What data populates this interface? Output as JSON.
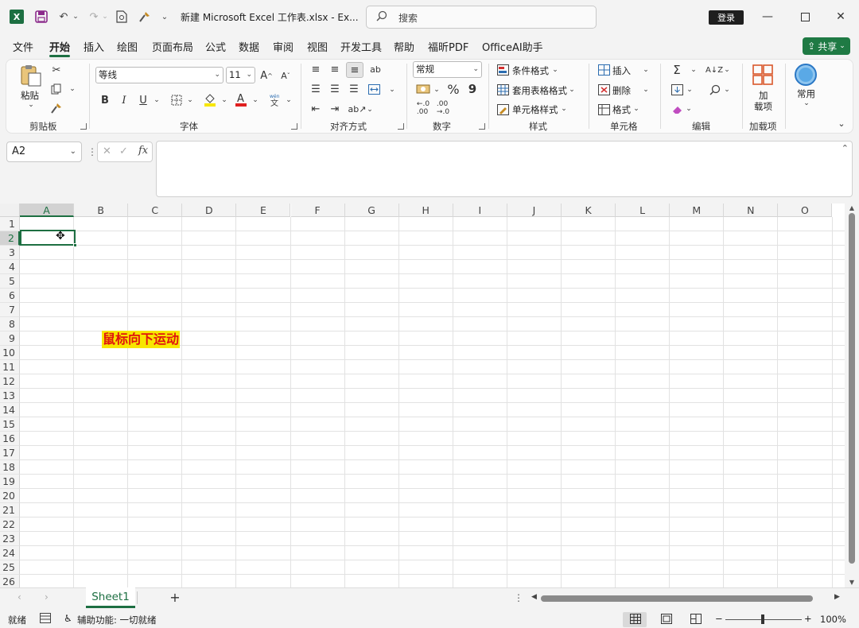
{
  "titlebar": {
    "doc_title": "新建 Microsoft Excel 工作表.xlsx  -  Ex...",
    "search_placeholder": "搜索",
    "login_label": "登录",
    "app_logo": "X"
  },
  "menu": {
    "items": [
      "文件",
      "开始",
      "插入",
      "绘图",
      "页面布局",
      "公式",
      "数据",
      "审阅",
      "视图",
      "开发工具",
      "帮助",
      "福昕PDF",
      "OfficeAI助手"
    ],
    "active": "开始",
    "share_label": "共享"
  },
  "ribbon": {
    "clipboard": {
      "paste_label": "粘贴",
      "group_label": "剪贴板"
    },
    "font": {
      "font_name": "等线",
      "font_size": "11",
      "bold": "B",
      "italic": "I",
      "underline": "U",
      "grow": "A^",
      "shrink": "Aˇ",
      "group_label": "字体"
    },
    "alignment": {
      "group_label": "对齐方式"
    },
    "number": {
      "format": "常规",
      "percent": "%",
      "comma": "9",
      "group_label": "数字"
    },
    "styles": {
      "conditional": "条件格式",
      "table": "套用表格格式",
      "cell_styles": "单元格样式",
      "group_label": "样式"
    },
    "cells": {
      "insert": "插入",
      "delete": "删除",
      "format": "格式",
      "group_label": "单元格"
    },
    "editing": {
      "group_label": "编辑"
    },
    "addins": {
      "label_line1": "加",
      "label_line2": "载项",
      "group_label": "加载项"
    },
    "common": {
      "label": "常用"
    }
  },
  "formula_bar": {
    "name_box": "A2",
    "fx": "fx",
    "content": ""
  },
  "grid": {
    "columns": [
      "A",
      "B",
      "C",
      "D",
      "E",
      "F",
      "G",
      "H",
      "I",
      "J",
      "K",
      "L",
      "M",
      "N",
      "O"
    ],
    "rows": [
      "1",
      "2",
      "3",
      "4",
      "5",
      "6",
      "7",
      "8",
      "9",
      "10",
      "11",
      "12",
      "13",
      "14",
      "15",
      "16",
      "17",
      "18",
      "19",
      "20",
      "21",
      "22",
      "23",
      "24",
      "25",
      "26"
    ],
    "selected_column": "A",
    "selected_row": "2"
  },
  "annotation": {
    "text": "鼠标向下运动"
  },
  "sheet_tabs": {
    "tabs": [
      "Sheet1"
    ],
    "add_label": "+"
  },
  "status": {
    "mode": "就绪",
    "accessibility": "辅助功能: 一切就绪",
    "zoom_minus": "−",
    "zoom_plus": "+",
    "zoom": "100%"
  },
  "colors": {
    "accent": "#1d6f42",
    "annotation_bg": "#f7e600",
    "annotation_fg": "#e0120f"
  },
  "icons": [
    "excel-logo-icon",
    "save-icon",
    "undo-icon",
    "redo-icon",
    "print-preview-icon",
    "format-painter-icon",
    "search-icon",
    "minimize-icon",
    "maximize-icon",
    "close-icon",
    "share-icon",
    "fx-icon"
  ]
}
